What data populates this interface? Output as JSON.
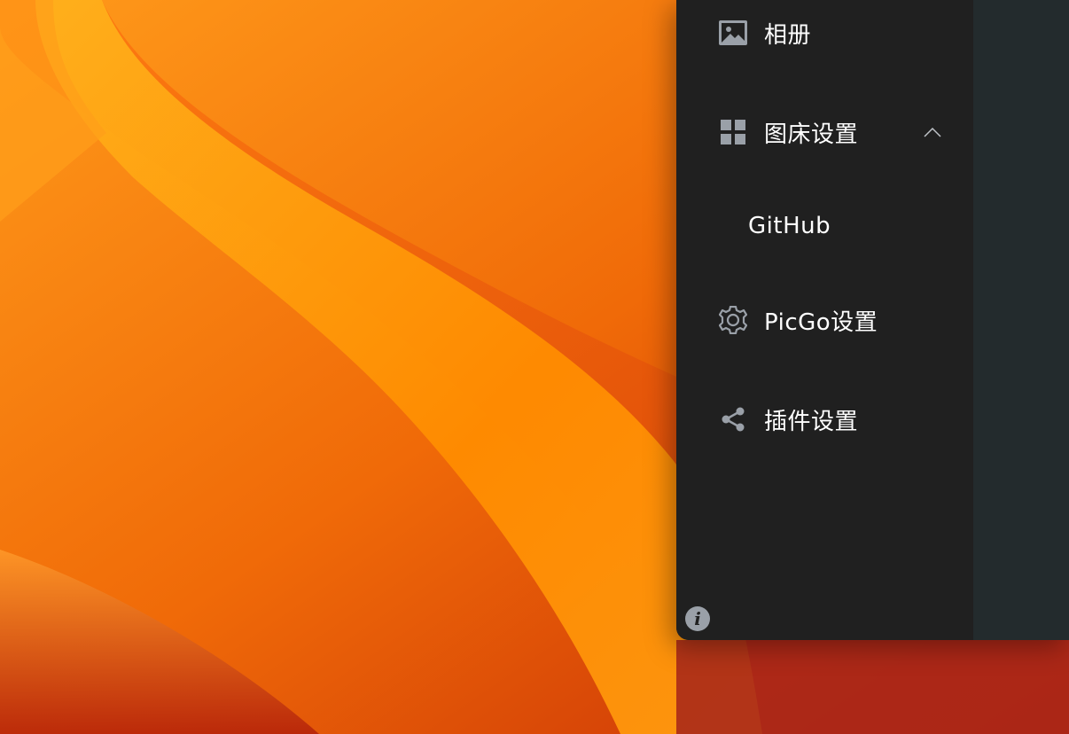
{
  "sidebar": {
    "items": [
      {
        "label": "相册",
        "icon": "image-icon"
      },
      {
        "label": "图床设置",
        "icon": "grid-icon",
        "expanded": true
      },
      {
        "label": "GitHub"
      },
      {
        "label": "PicGo设置",
        "icon": "gear-icon"
      },
      {
        "label": "插件设置",
        "icon": "share-icon"
      }
    ],
    "info_label": "i"
  },
  "colors": {
    "sidebar_bg": "#202020",
    "content_bg": "#232b2d",
    "text": "#ffffff",
    "icon": "#9aa0a8"
  }
}
